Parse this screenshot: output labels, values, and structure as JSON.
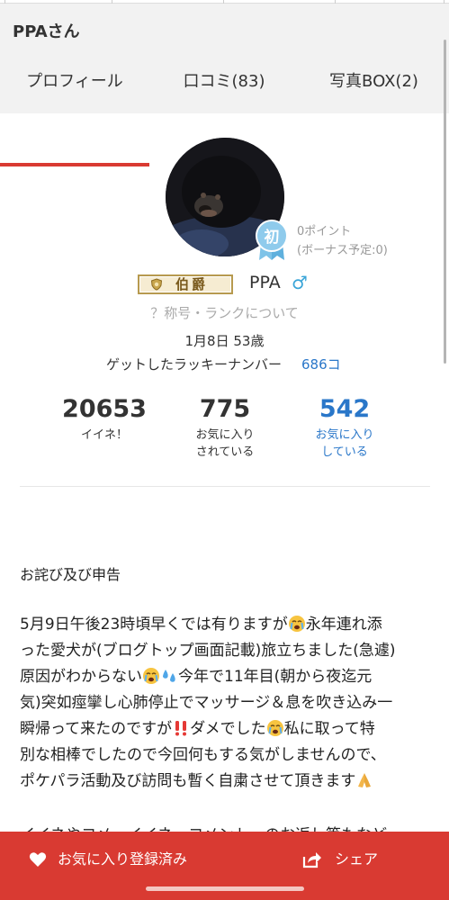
{
  "header": {
    "title": "PPAさん"
  },
  "tabs": [
    {
      "label": "プロフィール",
      "active": true
    },
    {
      "label": "口コミ(83)",
      "active": false
    },
    {
      "label": "写真BOX(2)",
      "active": false
    }
  ],
  "profile": {
    "avatar_icon": "dog-avatar",
    "badge": "初",
    "points": "0ポイント",
    "bonus": "(ボーナス予定:0)",
    "rank_title": "伯爵",
    "username": "PPA",
    "gender_symbol": "♂",
    "rank_link": "？称号・ランクについて",
    "birth": "1月8日 53歳",
    "lucky_label": "ゲットしたラッキーナンバー",
    "lucky_value": "686コ"
  },
  "stats": [
    {
      "value": "20653",
      "label_1": "イイネ！",
      "label_2": ""
    },
    {
      "value": "775",
      "label_1": "お気に入り",
      "label_2": "されている"
    },
    {
      "value": "542",
      "label_1": "お気に入り",
      "label_2": "している"
    }
  ],
  "post": {
    "title": "お詫び及び申告",
    "lines": [
      "5月9日午後23時頃早くでは有りますが",
      "永年連れ添",
      "った愛犬が(ブログトップ画面記載)旅立ちました(急遽)",
      "原因がわからない",
      "今年で11年目(朝から夜迄元",
      "気)突如痙攣し心肺停止でマッサージ＆息を吹き込み一",
      "瞬帰って来たのですが",
      "ダメでした",
      "私に取って特",
      "別な相棒でしたので今回何もする気がしませんので、",
      "ポケパラ活動及び訪問も暫く自粛させて頂きます"
    ],
    "cutoff": "イイネやコメ…イイネ…コメント…のお返し等もなど"
  },
  "bottom_bar": {
    "favorite_label": "お気に入り登録済み",
    "share_label": "シェア"
  },
  "colors": {
    "accent": "#d93a32",
    "link": "#2a77c9",
    "gender": "#3aa5d8"
  }
}
